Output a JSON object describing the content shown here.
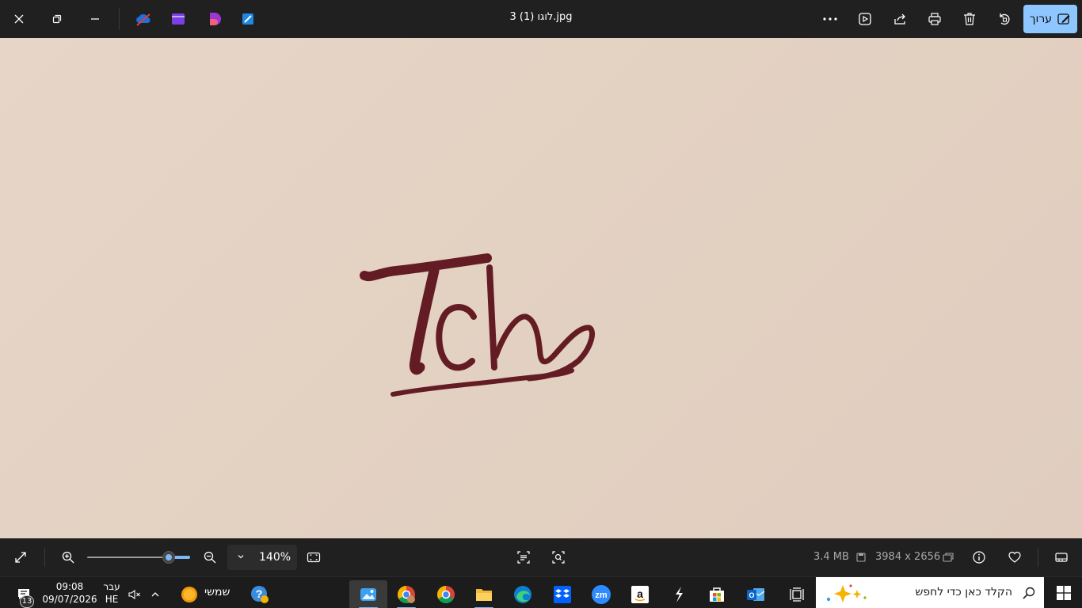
{
  "window": {
    "title": "3 לוגו (1).jpg",
    "edit_label": "ערוך"
  },
  "image": {
    "logo_text": "Tch",
    "ink_color": "#641c24",
    "background_color": "#e3d1c2"
  },
  "viewer": {
    "zoom_label": "140%",
    "zoom_percent": 140,
    "file_size": "3.4 MB",
    "dimensions": "3984 x 2656"
  },
  "taskbar": {
    "search_placeholder": "הקלד כאן כדי לחפש",
    "weather_label": "שמשי",
    "time": "09:08",
    "date": "09/07/2026",
    "lang_name": "עבר",
    "lang_code": "HE",
    "notification_count": "13"
  },
  "colors": {
    "accent": "#8ec6ff",
    "titlebar": "#202020",
    "taskbar": "#1c1c1c"
  }
}
